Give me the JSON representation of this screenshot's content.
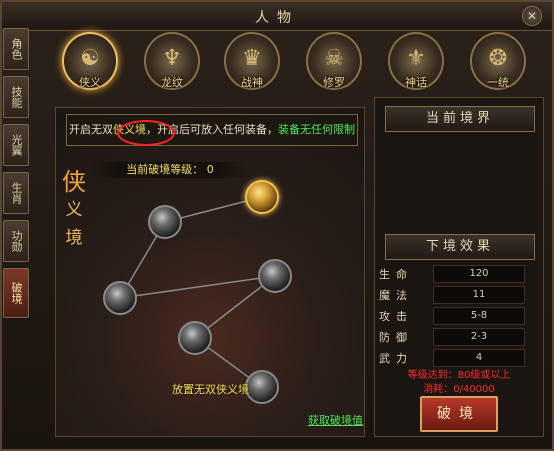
{
  "window": {
    "title": "人物"
  },
  "side_tabs": [
    {
      "label": "角色"
    },
    {
      "label": "技能"
    },
    {
      "label": "光翼"
    },
    {
      "label": "生肖"
    },
    {
      "label": "功勋"
    },
    {
      "label": "破境"
    }
  ],
  "top_tabs": [
    {
      "label": "侠义",
      "icon": "monk-icon"
    },
    {
      "label": "龙纹",
      "icon": "dragon-icon"
    },
    {
      "label": "战神",
      "icon": "warrior-icon"
    },
    {
      "label": "修罗",
      "icon": "demon-icon"
    },
    {
      "label": "神话",
      "icon": "myth-icon"
    },
    {
      "label": "一统",
      "icon": "unify-icon"
    }
  ],
  "info": {
    "pre": "开启无双",
    "link": "侠义境",
    "mid": "，开启后可放入任何装备，",
    "tail": "装备无任何限制"
  },
  "level_text": "当前破境等级：",
  "level_value": "0",
  "realm": {
    "big": "侠",
    "mid": "义",
    "small": "境"
  },
  "node_label": "放置无双侠义境",
  "get_link": "获取破境值",
  "right": {
    "current_header": "当前境界",
    "next_header": "下境效果",
    "stats": [
      {
        "label": "生命",
        "value": "120"
      },
      {
        "label": "魔法",
        "value": "11"
      },
      {
        "label": "攻击",
        "value": "5-8"
      },
      {
        "label": "防御",
        "value": "2-3"
      },
      {
        "label": "武力",
        "value": "4"
      }
    ],
    "req1": "等级达到：80级或以上",
    "req2": "消耗：0/40000",
    "button": "破境"
  }
}
